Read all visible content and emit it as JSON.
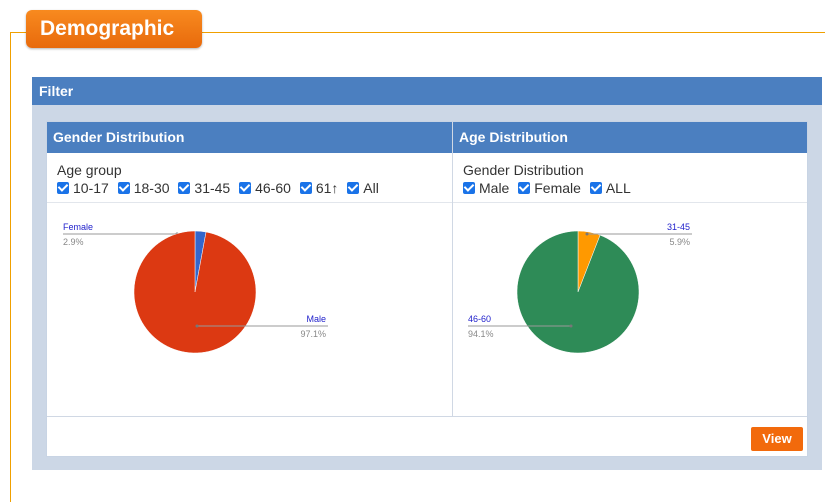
{
  "section": {
    "title": "Demographic"
  },
  "filter": {
    "title": "Filter"
  },
  "gender_panel": {
    "title": "Gender Distribution",
    "group_label": "Age group",
    "checkboxes": [
      {
        "label": "10-17",
        "checked": true
      },
      {
        "label": "18-30",
        "checked": true
      },
      {
        "label": "31-45",
        "checked": true
      },
      {
        "label": "46-60",
        "checked": true
      },
      {
        "label": "61↑",
        "checked": true
      },
      {
        "label": "All",
        "checked": true
      }
    ]
  },
  "age_panel": {
    "title": "Age Distribution",
    "group_label": "Gender Distribution",
    "checkboxes": [
      {
        "label": "Male",
        "checked": true
      },
      {
        "label": "Female",
        "checked": true
      },
      {
        "label": "ALL",
        "checked": true
      }
    ]
  },
  "chart_data": [
    {
      "type": "pie",
      "slices": [
        {
          "name": "Female",
          "value": 2.9,
          "label": "2.9%",
          "color": "#3366cc"
        },
        {
          "name": "Male",
          "value": 97.1,
          "label": "97.1%",
          "color": "#dc3912"
        }
      ]
    },
    {
      "type": "pie",
      "slices": [
        {
          "name": "31-45",
          "value": 5.9,
          "label": "5.9%",
          "color": "#ff9900"
        },
        {
          "name": "46-60",
          "value": 94.1,
          "label": "94.1%",
          "color": "#2e8b57"
        }
      ]
    }
  ],
  "actions": {
    "view_label": "View"
  },
  "colors": {
    "accent": "#f26a0c",
    "header": "#4b7fc0",
    "panel_bg": "#ccd7e6"
  }
}
